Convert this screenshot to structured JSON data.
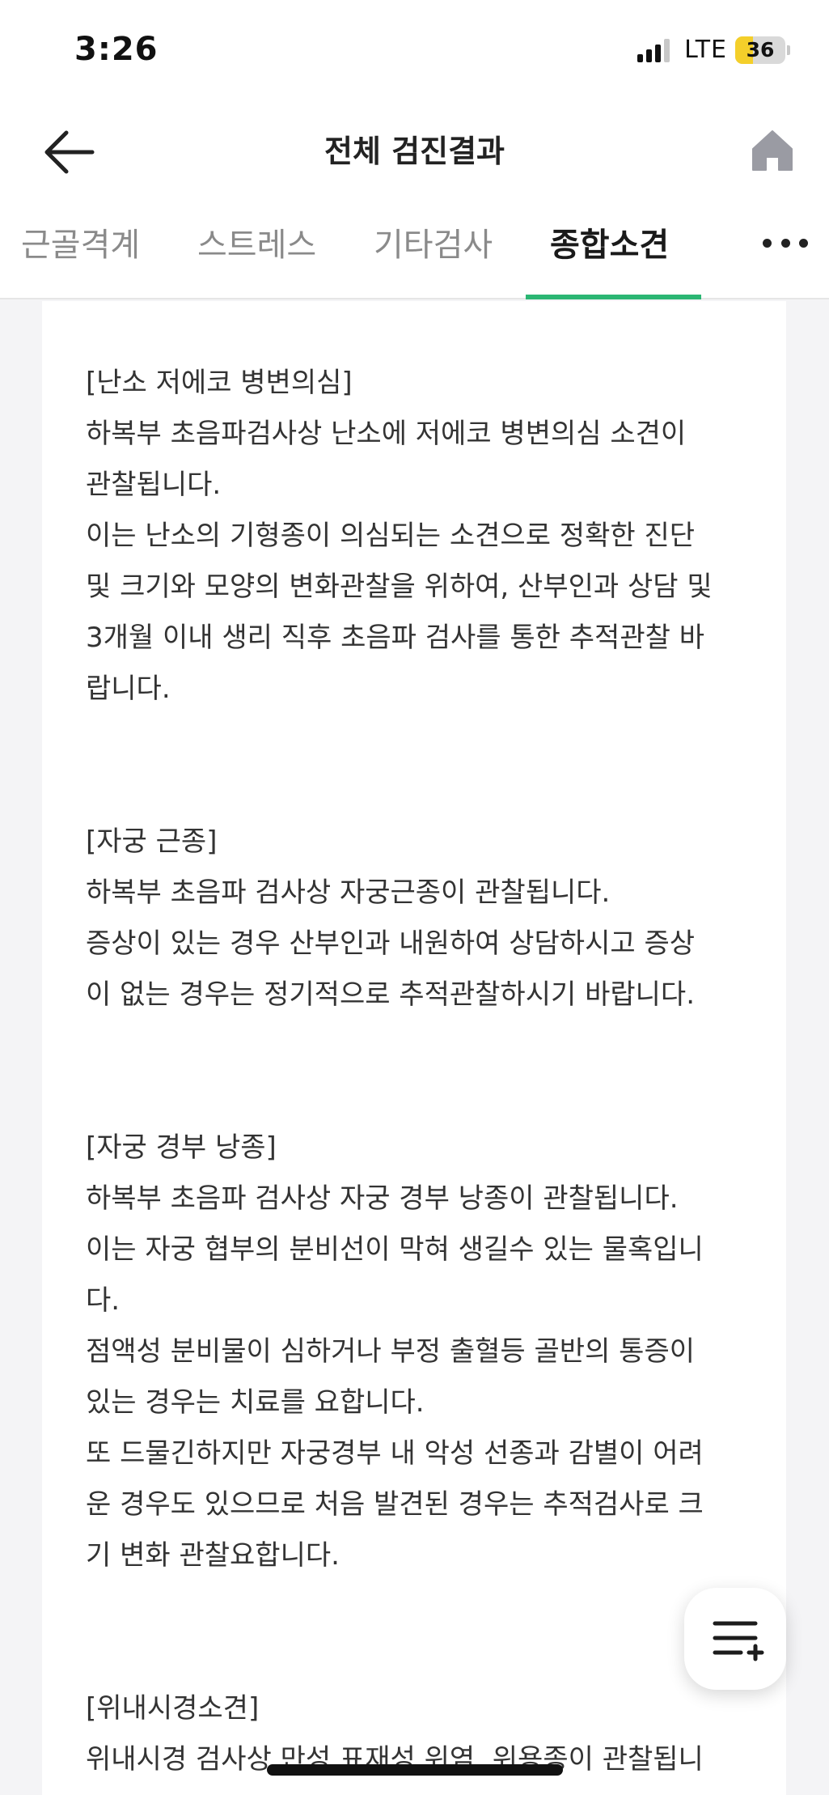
{
  "status_bar": {
    "time": "3:26",
    "network": "LTE",
    "battery_level": "36",
    "battery_fraction": 0.36
  },
  "header": {
    "title": "전체 검진결과",
    "back_icon": "arrow-left-icon",
    "home_icon": "home-icon"
  },
  "tabs": [
    {
      "label": "근골격계",
      "active": false
    },
    {
      "label": "스트레스",
      "active": false
    },
    {
      "label": "기타검사",
      "active": false
    },
    {
      "label": "종합소견",
      "active": true
    }
  ],
  "accent_color": "#2bb673",
  "sections": [
    {
      "lines": [
        "[난소 저에코 병변의심]",
        "하복부 초음파검사상 난소에 저에코 병변의심 소견이",
        "관찰됩니다.",
        " 이는 난소의 기형종이 의심되는 소견으로 정확한 진단",
        "및 크기와 모양의 변화관찰을 위하여, 산부인과 상담 및",
        "3개월 이내 생리 직후 초음파 검사를 통한 추적관찰 바",
        "랍니다."
      ]
    },
    {
      "lines": [
        "[자궁 근종]",
        "하복부 초음파 검사상 자궁근종이 관찰됩니다.",
        " 증상이 있는 경우 산부인과 내원하여 상담하시고 증상",
        "이 없는 경우는 정기적으로 추적관찰하시기 바랍니다."
      ]
    },
    {
      "lines": [
        "[자궁 경부 낭종]",
        "하복부 초음파 검사상 자궁 경부 낭종이 관찰됩니다.",
        " 이는 자궁 협부의 분비선이 막혀 생길수 있는 물혹입니",
        "다.",
        " 점액성 분비물이 심하거나 부정 출혈등 골반의 통증이",
        "있는 경우는 치료를 요합니다.",
        " 또 드물긴하지만 자궁경부 내 악성 선종과 감별이 어려",
        "운 경우도 있으므로 처음 발견된 경우는 추적검사로 크",
        "기 변화 관찰요합니다."
      ]
    },
    {
      "lines": [
        "[위내시경소견]",
        "위내시경 검사상 만성 표재성 위염, 위용종이 관찰됩니"
      ]
    }
  ],
  "fab": {
    "icon": "list-add-icon"
  }
}
